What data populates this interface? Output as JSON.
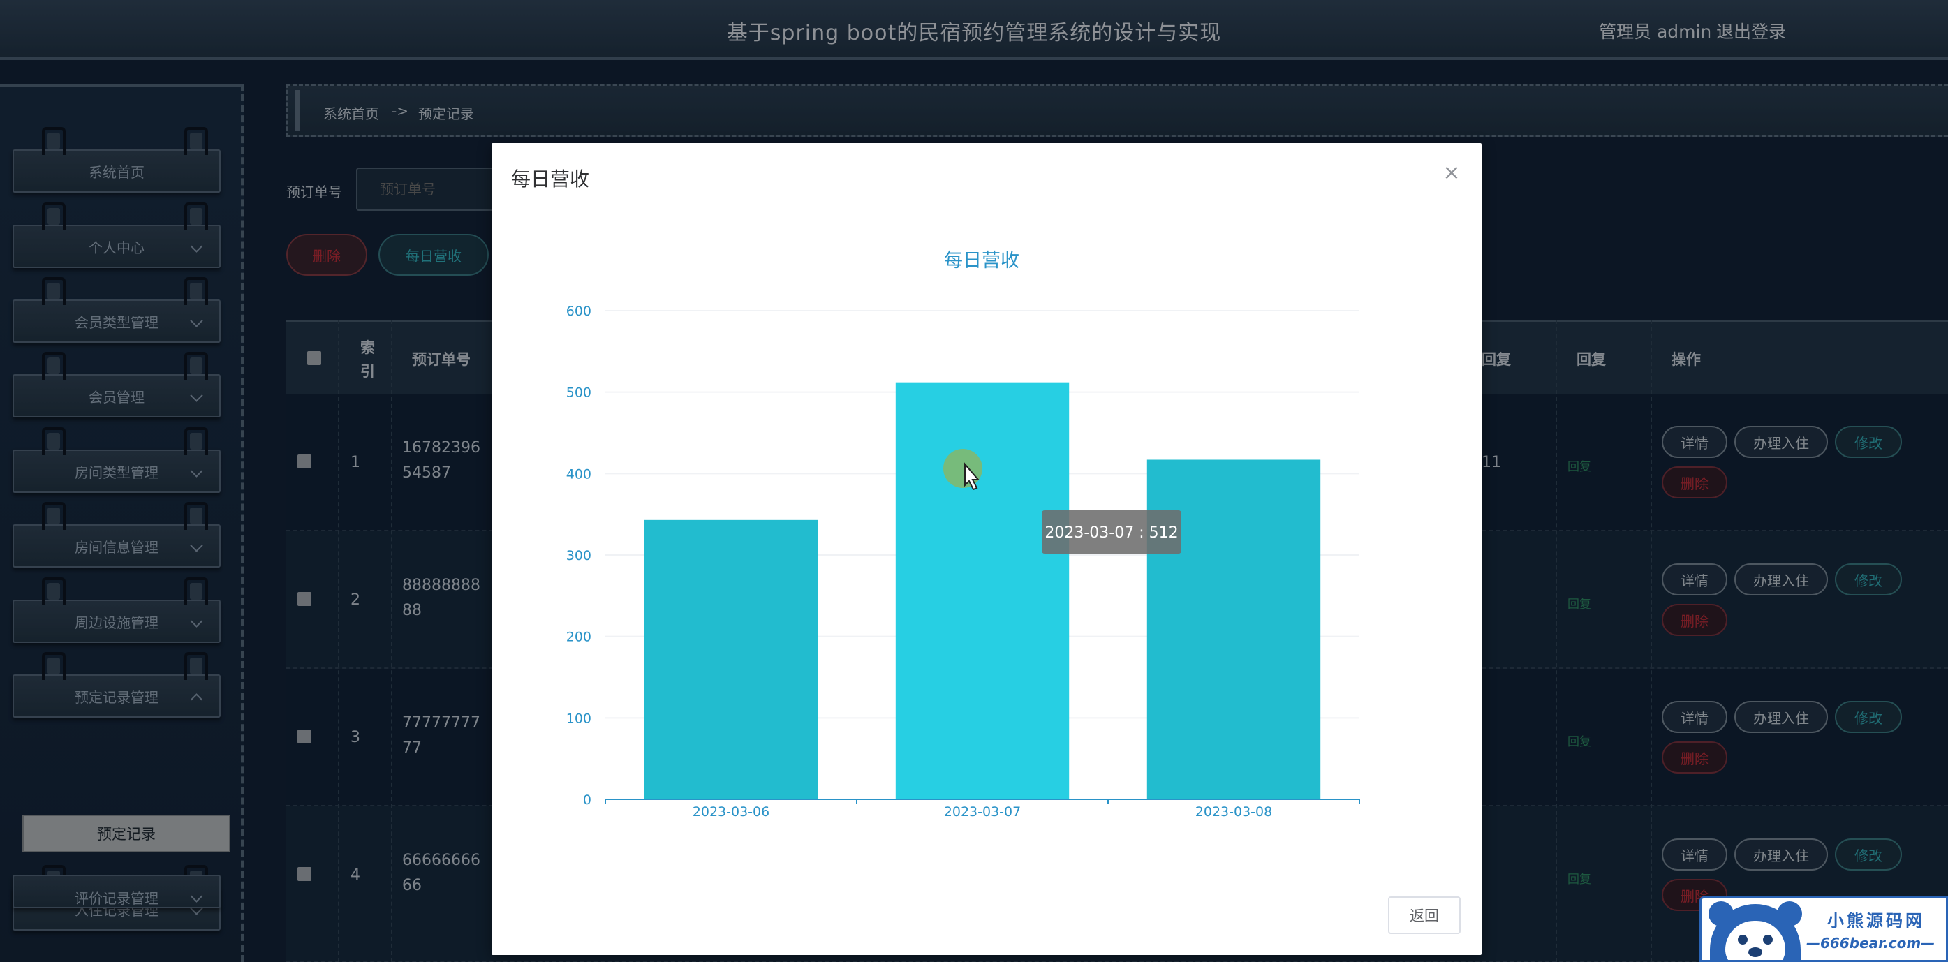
{
  "header": {
    "title": "基于spring boot的民宿预约管理系统的设计与实现",
    "user": "管理员 admin",
    "logout": "退出登录"
  },
  "sidebar": {
    "items": [
      {
        "label": "系统首页",
        "has_arrow": false
      },
      {
        "label": "个人中心",
        "has_arrow": true
      },
      {
        "label": "会员类型管理",
        "has_arrow": true
      },
      {
        "label": "会员管理",
        "has_arrow": true
      },
      {
        "label": "房间类型管理",
        "has_arrow": true
      },
      {
        "label": "房间信息管理",
        "has_arrow": true
      },
      {
        "label": "周边设施管理",
        "has_arrow": true
      },
      {
        "label": "预定记录管理",
        "has_arrow": true,
        "expanded": true
      },
      {
        "label": "入住记录管理",
        "has_arrow": true
      },
      {
        "label": "评价记录管理",
        "has_arrow": true
      }
    ],
    "sub_item": "预定记录"
  },
  "breadcrumb": {
    "home": "系统首页",
    "separator": "->",
    "current": "预定记录"
  },
  "search": {
    "label": "预订单号",
    "placeholder": "预订单号"
  },
  "actions": {
    "delete": "删除",
    "daily_revenue": "每日营收"
  },
  "table": {
    "headers": {
      "index": "索引",
      "order_no": "预订单号",
      "reply_status": "回复",
      "reply": "回复",
      "operations": "操作"
    },
    "rows": [
      {
        "index": "1",
        "order_no": "1678239654587",
        "extra": "11",
        "reply": "回复"
      },
      {
        "index": "2",
        "order_no": "8888888888",
        "extra": "",
        "reply": "回复"
      },
      {
        "index": "3",
        "order_no": "7777777777",
        "extra": "",
        "reply": "回复"
      },
      {
        "index": "4",
        "order_no": "6666666666",
        "extra": "",
        "reply": "回复"
      }
    ],
    "row_actions": {
      "detail": "详情",
      "check_in": "办理入住",
      "modify": "修改",
      "delete": "删除"
    }
  },
  "modal": {
    "title": "每日营收",
    "close_symbol": "×",
    "back_label": "返回",
    "tooltip": "2023-03-07 : 512"
  },
  "chart_data": {
    "type": "bar",
    "title": "每日营收",
    "categories": [
      "2023-03-06",
      "2023-03-07",
      "2023-03-08"
    ],
    "values": [
      343,
      512,
      417
    ],
    "ylim": [
      0,
      600
    ],
    "yticks": [
      0,
      100,
      200,
      300,
      400,
      500,
      600
    ],
    "xlabel": "",
    "ylabel": "",
    "grid": true,
    "colors": {
      "bar": "#22bccf",
      "bar_highlight": "#27cfe3",
      "axis_text": "#2a93c8",
      "title": "#2a93c8"
    }
  },
  "watermark": {
    "name": "小熊源码网",
    "url": "—666bear.com—"
  }
}
